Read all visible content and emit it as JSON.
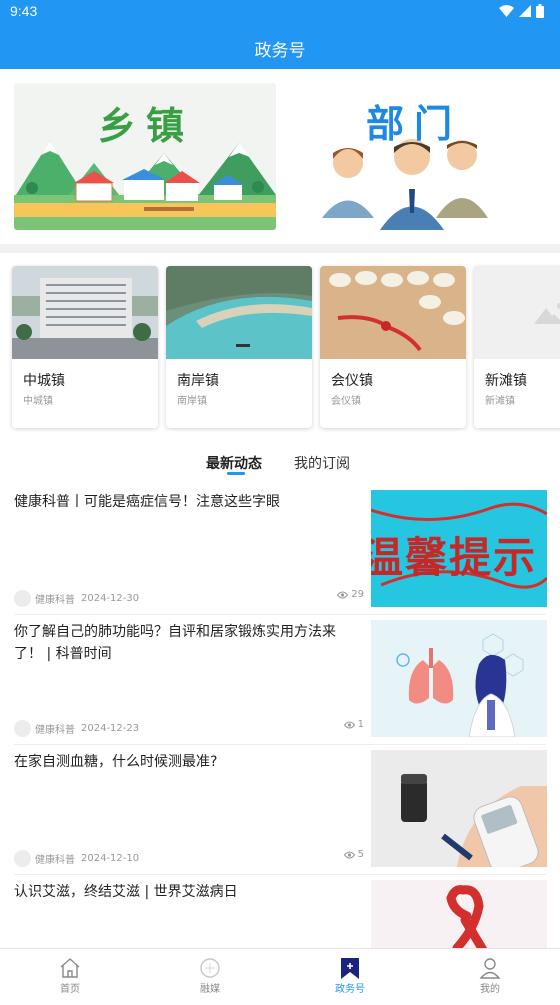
{
  "status_bar": {
    "time": "9:43"
  },
  "header": {
    "title": "政务号"
  },
  "tiles": [
    {
      "label": "乡镇"
    },
    {
      "label": "部门"
    }
  ],
  "towns": [
    {
      "name": "中城镇",
      "sub": "中城镇"
    },
    {
      "name": "南岸镇",
      "sub": "南岸镇"
    },
    {
      "name": "会仪镇",
      "sub": "会仪镇"
    },
    {
      "name": "新滩镇",
      "sub": "新滩镇"
    }
  ],
  "tabs": {
    "active": "最新动态",
    "inactive": "我的订阅"
  },
  "news": [
    {
      "title": "健康科普丨可能是癌症信号！注意这些字眼",
      "source": "健康科普",
      "date": "2024-12-30",
      "views": "29",
      "thumb_text": "温馨提示"
    },
    {
      "title": "你了解自己的肺功能吗？自评和居家锻炼实用方法来了！ | 科普时间",
      "source": "健康科普",
      "date": "2024-12-23",
      "views": "1"
    },
    {
      "title": "在家自测血糖，什么时候测最准?",
      "source": "健康科普",
      "date": "2024-12-10",
      "views": "5"
    },
    {
      "title": "认识艾滋，终结艾滋 | 世界艾滋病日",
      "source": "",
      "date": "",
      "views": ""
    }
  ],
  "bottom_nav": [
    {
      "label": "首页",
      "icon": "home-icon"
    },
    {
      "label": "融媒",
      "icon": "media-icon"
    },
    {
      "label": "政务号",
      "icon": "gov-account-icon",
      "active": true
    },
    {
      "label": "我的",
      "icon": "profile-icon"
    }
  ]
}
